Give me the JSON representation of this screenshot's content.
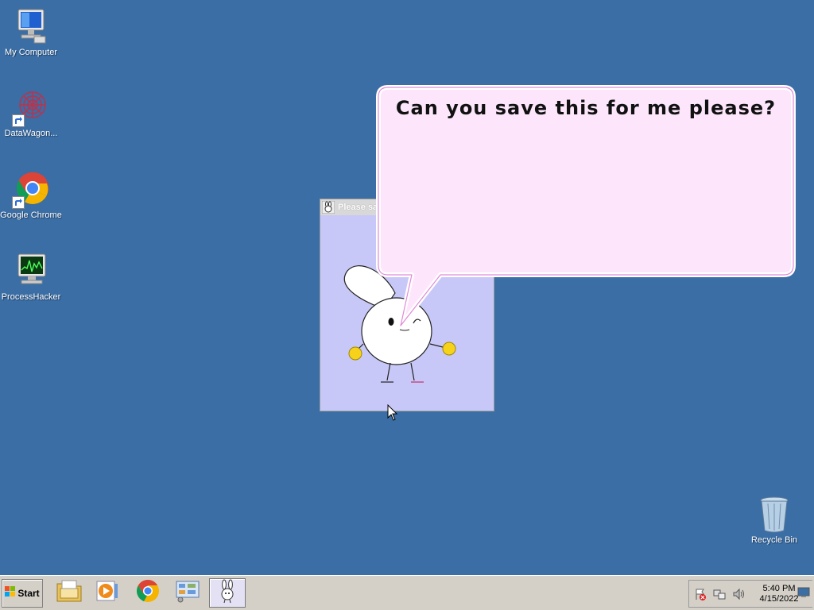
{
  "desktop": {
    "icons": [
      {
        "label": "My Computer"
      },
      {
        "label": "DataWagon..."
      },
      {
        "label": "Google Chrome"
      },
      {
        "label": "ProcessHacker"
      }
    ],
    "recycle_bin": {
      "label": "Recycle Bin"
    }
  },
  "app_window": {
    "title": "Please sa"
  },
  "speech_bubble": {
    "text": "Can you save this for me please?"
  },
  "taskbar": {
    "start_label": "Start",
    "buttons": [
      {
        "icon": "file-explorer-icon"
      },
      {
        "icon": "media-player-icon"
      },
      {
        "icon": "chrome-icon"
      },
      {
        "icon": "control-panel-icon"
      },
      {
        "icon": "bunny-app-icon",
        "active": true
      }
    ],
    "tray": {
      "time": "5:40 PM",
      "date": "4/15/2022"
    }
  },
  "colors": {
    "desktop": "#3a6ea5",
    "taskbar": "#d4d0c8",
    "bubble_fill": "#fde6fb",
    "bubble_border": "#e08ad8",
    "window_bg": "#c8c8f8"
  }
}
